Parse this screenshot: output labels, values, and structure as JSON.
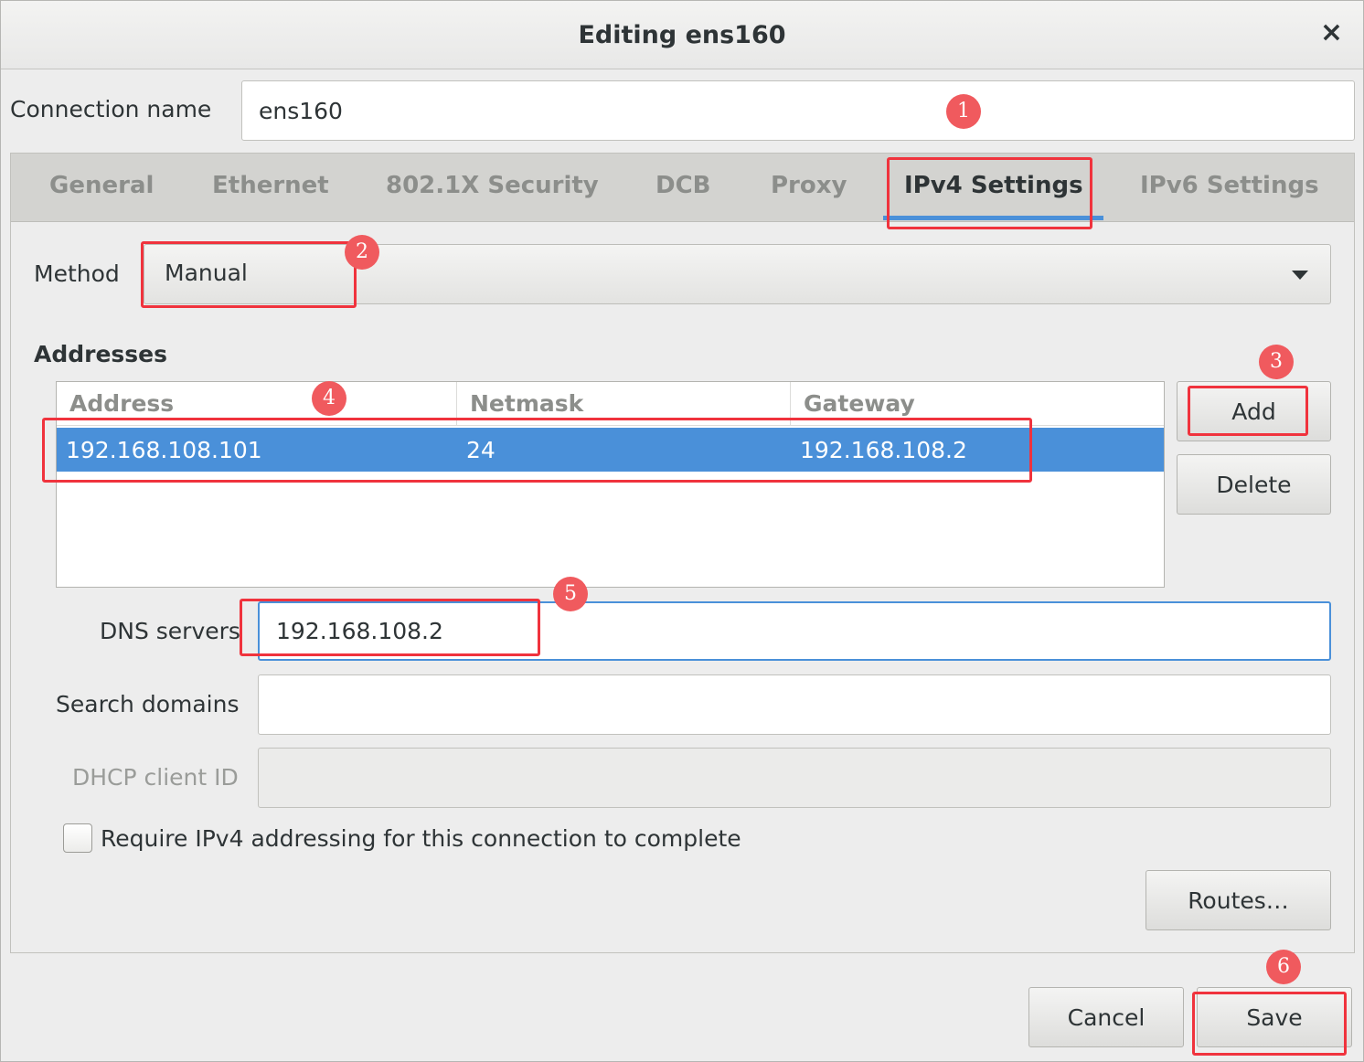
{
  "window": {
    "title": "Editing ens160",
    "close_glyph": "×"
  },
  "connection": {
    "label": "Connection name",
    "value": "ens160"
  },
  "tabs": [
    {
      "label": "General"
    },
    {
      "label": "Ethernet"
    },
    {
      "label": "802.1X Security"
    },
    {
      "label": "DCB"
    },
    {
      "label": "Proxy"
    },
    {
      "label": "IPv4 Settings",
      "active": true
    },
    {
      "label": "IPv6 Settings"
    }
  ],
  "ipv4": {
    "method_label": "Method",
    "method_value": "Manual",
    "addresses_title": "Addresses",
    "columns": [
      "Address",
      "Netmask",
      "Gateway"
    ],
    "rows": [
      {
        "address": "192.168.108.101",
        "netmask": "24",
        "gateway": "192.168.108.2"
      }
    ],
    "add_label": "Add",
    "delete_label": "Delete",
    "dns_label": "DNS servers",
    "dns_value": "192.168.108.2",
    "search_label": "Search domains",
    "search_value": "",
    "dhcp_label": "DHCP client ID",
    "dhcp_value": "",
    "require_label": "Require IPv4 addressing for this connection to complete",
    "require_checked": false,
    "routes_label": "Routes…"
  },
  "footer": {
    "cancel_label": "Cancel",
    "save_label": "Save"
  },
  "annotations": [
    "1",
    "2",
    "3",
    "4",
    "5",
    "6"
  ],
  "colors": {
    "accent": "#4a90d9",
    "annotation": "#f0333d"
  }
}
